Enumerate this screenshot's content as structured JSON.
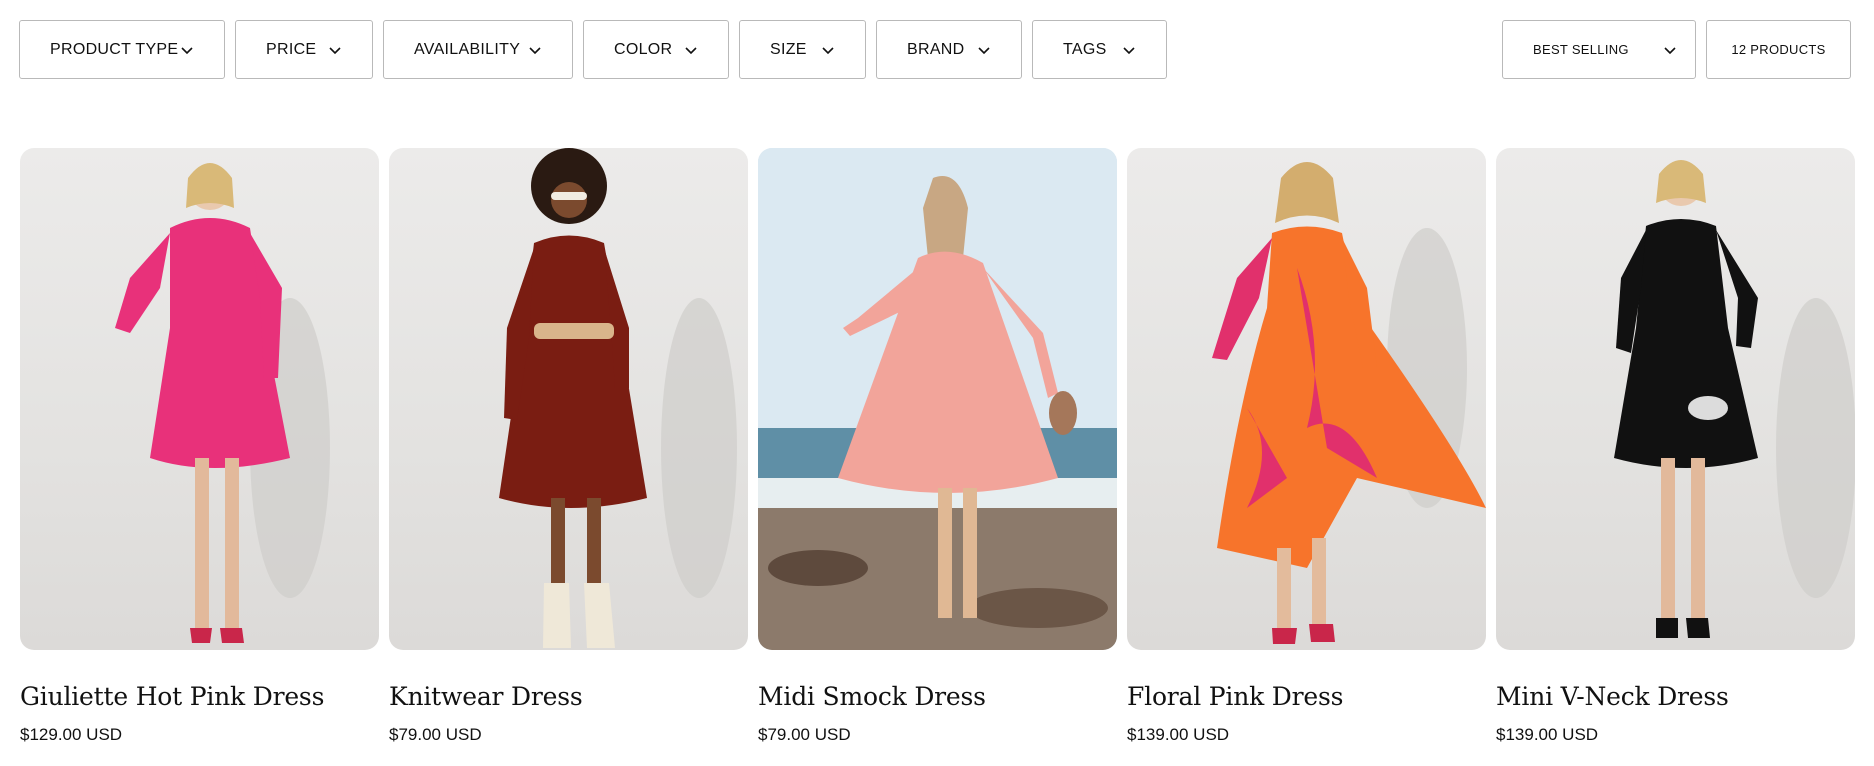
{
  "filters": [
    {
      "label": "PRODUCT TYPE"
    },
    {
      "label": "PRICE"
    },
    {
      "label": "AVAILABILITY"
    },
    {
      "label": "COLOR"
    },
    {
      "label": "SIZE"
    },
    {
      "label": "BRAND"
    },
    {
      "label": "TAGS"
    }
  ],
  "sort": {
    "selected": "BEST SELLING",
    "icon": "chevron-down-icon"
  },
  "product_count": "12 PRODUCTS",
  "products": [
    {
      "title": "Giuliette Hot Pink Dress",
      "price": "$129.00 USD",
      "dress_color": "#e8317a"
    },
    {
      "title": "Knitwear Dress",
      "price": "$79.00 USD",
      "dress_color": "#7a1d12"
    },
    {
      "title": "Midi Smock Dress",
      "price": "$79.00 USD",
      "dress_color": "#f2a49a"
    },
    {
      "title": "Floral Pink Dress",
      "price": "$139.00 USD",
      "dress_color": "#f7742b"
    },
    {
      "title": "Mini V-Neck Dress",
      "price": "$139.00 USD",
      "dress_color": "#111111"
    }
  ]
}
